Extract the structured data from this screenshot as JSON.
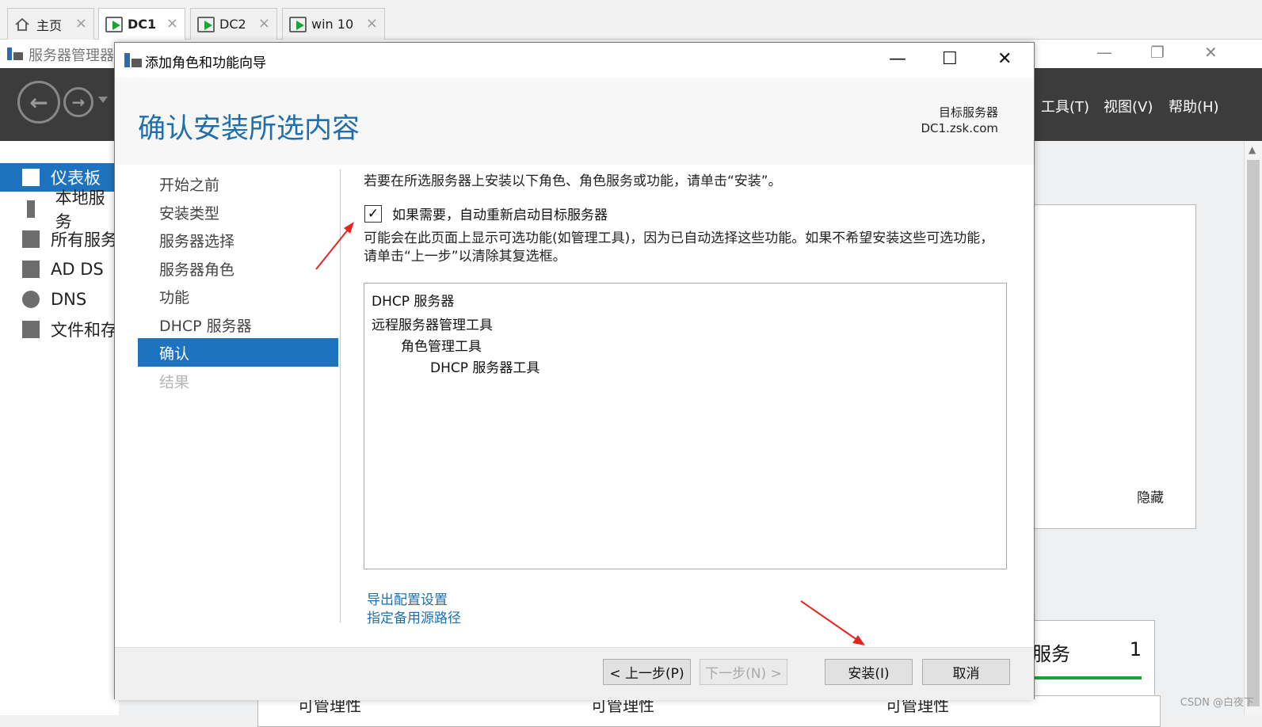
{
  "vm_tabs": [
    {
      "label": "主页",
      "icon": "home-icon"
    },
    {
      "label": "DC1",
      "icon": "vm-running-icon",
      "active": true
    },
    {
      "label": "DC2",
      "icon": "vm-running-icon"
    },
    {
      "label": "win 10",
      "icon": "vm-running-icon"
    }
  ],
  "server_manager": {
    "title": "服务器管理器",
    "menu": [
      "工具(T)",
      "视图(V)",
      "帮助(H)"
    ],
    "sidebar": [
      {
        "label": "仪表板",
        "icon": "dashboard-icon"
      },
      {
        "label": "本地服务",
        "icon": "server-icon"
      },
      {
        "label": "所有服务",
        "icon": "servers-icon"
      },
      {
        "label": "AD DS",
        "icon": "ad-ds-icon"
      },
      {
        "label": "DNS",
        "icon": "dns-icon"
      },
      {
        "label": "文件和存",
        "icon": "file-storage-icon"
      }
    ],
    "hide_label": "隐藏",
    "tile_title": "服务",
    "tile_count": "1",
    "manageability": "可管理性"
  },
  "dialog": {
    "title": "添加角色和功能向导",
    "heading": "确认安装所选内容",
    "target_label": "目标服务器",
    "target_server": "DC1.zsk.com",
    "steps": [
      {
        "label": "开始之前",
        "state": "normal"
      },
      {
        "label": "安装类型",
        "state": "normal"
      },
      {
        "label": "服务器选择",
        "state": "normal"
      },
      {
        "label": "服务器角色",
        "state": "normal"
      },
      {
        "label": "功能",
        "state": "normal"
      },
      {
        "label": "DHCP 服务器",
        "state": "normal"
      },
      {
        "label": "确认",
        "state": "active"
      },
      {
        "label": "结果",
        "state": "disabled"
      }
    ],
    "intro": "若要在所选服务器上安装以下角色、角色服务或功能，请单击“安装”。",
    "restart_checkbox": {
      "label": "如果需要，自动重新启动目标服务器",
      "checked": true
    },
    "note": "可能会在此页面上显示可选功能(如管理工具)，因为已自动选择这些功能。如果不希望安装这些可选功能，请单击“上一步”以清除其复选框。",
    "items": [
      {
        "label": "DHCP 服务器",
        "level": 0
      },
      {
        "label": "远程服务器管理工具",
        "level": 0
      },
      {
        "label": "角色管理工具",
        "level": 1
      },
      {
        "label": "DHCP 服务器工具",
        "level": 2
      }
    ],
    "links": [
      "导出配置设置",
      "指定备用源路径"
    ],
    "buttons": {
      "prev": "< 上一步(P)",
      "next": "下一步(N) >",
      "install": "安装(I)",
      "cancel": "取消"
    }
  },
  "watermark": "CSDN @白夜下",
  "colors": {
    "accent": "#1e73be",
    "heading": "#1f6fab",
    "annotation": "#e8231f",
    "status_green": "#1aa33a"
  }
}
